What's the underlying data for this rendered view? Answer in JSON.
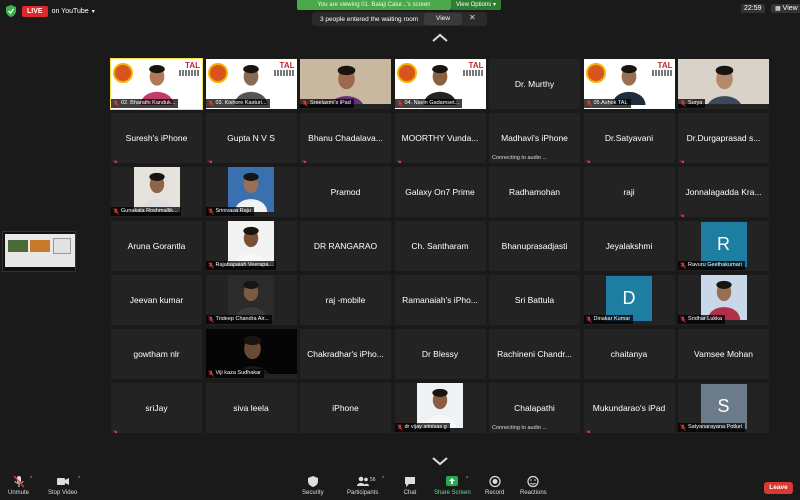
{
  "top": {
    "live_badge": "LIVE",
    "live_on": "on YouTube",
    "banner": "You are viewing 01. Balaji Calur...'s screen",
    "view_options": "View Options",
    "waiting_msg": "3 people entered the waiting room",
    "view_button": "View",
    "clock": "22:59",
    "view_label": "View"
  },
  "tiles": [
    {
      "name": "02. Bharathi Kanduk...",
      "type": "tal",
      "active": true,
      "skin": "#b07a5a",
      "cloth": "#c23b6a"
    },
    {
      "name": "03. Kishore Kasturi...",
      "type": "tal",
      "skin": "#8a6a50",
      "cloth": "#555"
    },
    {
      "name": "Sreelaxmi's iPad",
      "type": "video",
      "bg": "#c9b8a0",
      "skin": "#9b6a4a",
      "cloth": "#6a2f7a"
    },
    {
      "name": "04. Navin Gadamset...",
      "type": "tal",
      "skin": "#8a6040",
      "cloth": "#222"
    },
    {
      "name": "Dr. Murthy",
      "type": "name"
    },
    {
      "name": "05.Ashok TAL",
      "type": "tal",
      "skin": "#9a7050",
      "cloth": "#1e2c3c"
    },
    {
      "name": "Surya",
      "type": "video",
      "bg": "#d8d2c8",
      "skin": "#b58a6a",
      "cloth": "#3a4a5a"
    },
    {
      "name": "Suresh's iPhone",
      "type": "name",
      "muted": true
    },
    {
      "name": "Gupta N V S",
      "type": "name",
      "muted": true
    },
    {
      "name": "Bhanu Chadalava...",
      "type": "name",
      "muted": true
    },
    {
      "name": "MOORTHY Vunda...",
      "type": "name",
      "muted": true
    },
    {
      "name": "Madhavi's iPhone",
      "type": "name",
      "connecting": "Connecting to audio ..."
    },
    {
      "name": "Dr.Satyavani",
      "type": "name",
      "muted": true
    },
    {
      "name": "Dr.Durgaprasad s...",
      "type": "name",
      "muted": true
    },
    {
      "name": "Gunakala Roshmallik...",
      "type": "photo",
      "bg": "#e6e2dc",
      "skin": "#8b6648",
      "cloth": "#ddd"
    },
    {
      "name": "Srinivasa Raju",
      "type": "photo",
      "bg": "#3a6fb0",
      "skin": "#9a7054",
      "cloth": "#f2f2f2"
    },
    {
      "name": "Pramod",
      "type": "name"
    },
    {
      "name": "Galaxy On7 Prime",
      "type": "name"
    },
    {
      "name": "Radhamohan",
      "type": "name"
    },
    {
      "name": "raji",
      "type": "name"
    },
    {
      "name": "Jonnalagadda Kra...",
      "type": "name",
      "muted": true
    },
    {
      "name": "Aruna Gorantla",
      "type": "name"
    },
    {
      "name": "Rajabapaiah Veerapa...",
      "type": "photo",
      "bg": "#f2f2f2",
      "skin": "#7a5036",
      "cloth": "#f7f7f7"
    },
    {
      "name": "DR RANGARAO",
      "type": "name"
    },
    {
      "name": "Ch. Santharam",
      "type": "name"
    },
    {
      "name": "Bhanuprasadjasti",
      "type": "name"
    },
    {
      "name": "Jeyalakshmi",
      "type": "name"
    },
    {
      "name": "Ravuru Geethakumari",
      "type": "avatar",
      "letter": "R",
      "color": "#1e7ea1"
    },
    {
      "name": "Jeevan kumar",
      "type": "name"
    },
    {
      "name": "Trideep Chandra Air...",
      "type": "photo",
      "bg": "#2b2b2b",
      "skin": "#7b5a40",
      "cloth": "#3a3a3a"
    },
    {
      "name": "raj -mobile",
      "type": "name"
    },
    {
      "name": "Ramanaiah's iPho...",
      "type": "name"
    },
    {
      "name": "Sri Battula",
      "type": "name"
    },
    {
      "name": "Dinakar Kumar",
      "type": "avatar",
      "letter": "D",
      "color": "#1e7ea1"
    },
    {
      "name": "Sridhar Lukka",
      "type": "photo",
      "bg": "#c8d8e8",
      "skin": "#9a6e50",
      "cloth": "#b0304a"
    },
    {
      "name": "gowtham nlr",
      "type": "name"
    },
    {
      "name": "Viji kaza Sudhakar",
      "type": "video",
      "bg": "#050505",
      "skin": "#6a4a34",
      "cloth": "#1a1a1a"
    },
    {
      "name": "Chakradhar's iPho...",
      "type": "name"
    },
    {
      "name": "Dr Blessy",
      "type": "name"
    },
    {
      "name": "Rachineni Chandr...",
      "type": "name"
    },
    {
      "name": "chaitanya",
      "type": "name"
    },
    {
      "name": "Vamsee Mohan",
      "type": "name"
    },
    {
      "name": "sriJay",
      "type": "name",
      "muted": true
    },
    {
      "name": "siva leela",
      "type": "name"
    },
    {
      "name": "iPhone",
      "type": "name"
    },
    {
      "name": "dr vijay srinivas g",
      "type": "photo",
      "bg": "#eef2f4",
      "skin": "#8a5e42",
      "cloth": "#f6f6f6"
    },
    {
      "name": "Chalapathi",
      "type": "name",
      "connecting": "Connecting to audio ..."
    },
    {
      "name": "Mukundarao's iPad",
      "type": "name",
      "muted": true
    },
    {
      "name": "Satyanarayana Potluri",
      "type": "avatar",
      "letter": "S",
      "color": "#6b7b8a"
    }
  ],
  "tal": {
    "badge": "TAL"
  },
  "toolbar": {
    "unmute": "Unmute",
    "stop_video": "Stop Video",
    "security": "Security",
    "participants": "Participants",
    "participants_count": "56",
    "chat": "Chat",
    "share_screen": "Share Screen",
    "record": "Record",
    "reactions": "Reactions",
    "leave": "Leave"
  },
  "colors": {
    "background": "#1a1a1a",
    "tile": "#232323",
    "live": "#e02828",
    "banner": "#4ba84b",
    "share": "#2aa94b",
    "leave": "#d83a31",
    "muted_mic": "#e03a3a",
    "active_border": "#f4e04d"
  },
  "icons": [
    "shield-icon",
    "chevron-up-icon",
    "chevron-down-icon",
    "microphone-muted-icon",
    "video-camera-icon",
    "security-shield-icon",
    "participants-icon",
    "chat-icon",
    "share-screen-icon",
    "record-icon",
    "reactions-icon",
    "close-icon"
  ]
}
